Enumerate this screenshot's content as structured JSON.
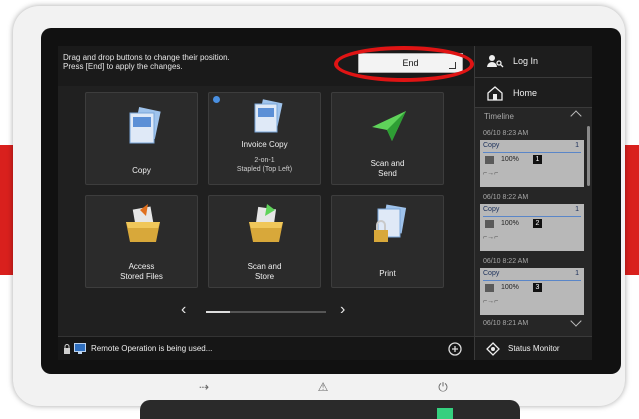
{
  "instructions": {
    "line1": "Drag and drop buttons to change their position.",
    "line2": "Press [End] to apply the changes."
  },
  "end_button": {
    "label": "End"
  },
  "tiles": [
    {
      "label": "Copy",
      "sub": ""
    },
    {
      "label": "Invoice Copy",
      "sub1": "2-on-1",
      "sub2": "Stapled (Top Left)"
    },
    {
      "label1": "Scan and",
      "label2": "Send"
    },
    {
      "label1": "Access",
      "label2": "Stored Files"
    },
    {
      "label1": "Scan and",
      "label2": "Store"
    },
    {
      "label": "Print"
    }
  ],
  "nav": {
    "prev": "‹",
    "next": "›",
    "page_fraction": 0.2
  },
  "status_bar": {
    "text": "Remote Operation is being used..."
  },
  "sidebar": {
    "login": "Log In",
    "home": "Home",
    "timeline_title": "Timeline",
    "entries": [
      {
        "time": "06/10 8:23 AM",
        "job": "Copy",
        "qty": "1",
        "zoom": "100%",
        "copies": "1"
      },
      {
        "time": "06/10 8:22 AM",
        "job": "Copy",
        "qty": "1",
        "zoom": "100%",
        "copies": "2"
      },
      {
        "time": "06/10 8:22 AM",
        "job": "Copy",
        "qty": "1",
        "zoom": "100%",
        "copies": "3"
      }
    ],
    "last_time": "06/10 8:21 AM",
    "status_monitor": "Status Monitor"
  },
  "colors": {
    "accent_red": "#d9201d",
    "highlight_oval": "#e01414",
    "ready_light": "#35d07f"
  },
  "icons": [
    "login-icon",
    "home-icon",
    "status-monitor-icon",
    "lock-icon",
    "remote-icon",
    "energy-saver-icon",
    "counter-icon",
    "warning-icon",
    "power-icon"
  ]
}
